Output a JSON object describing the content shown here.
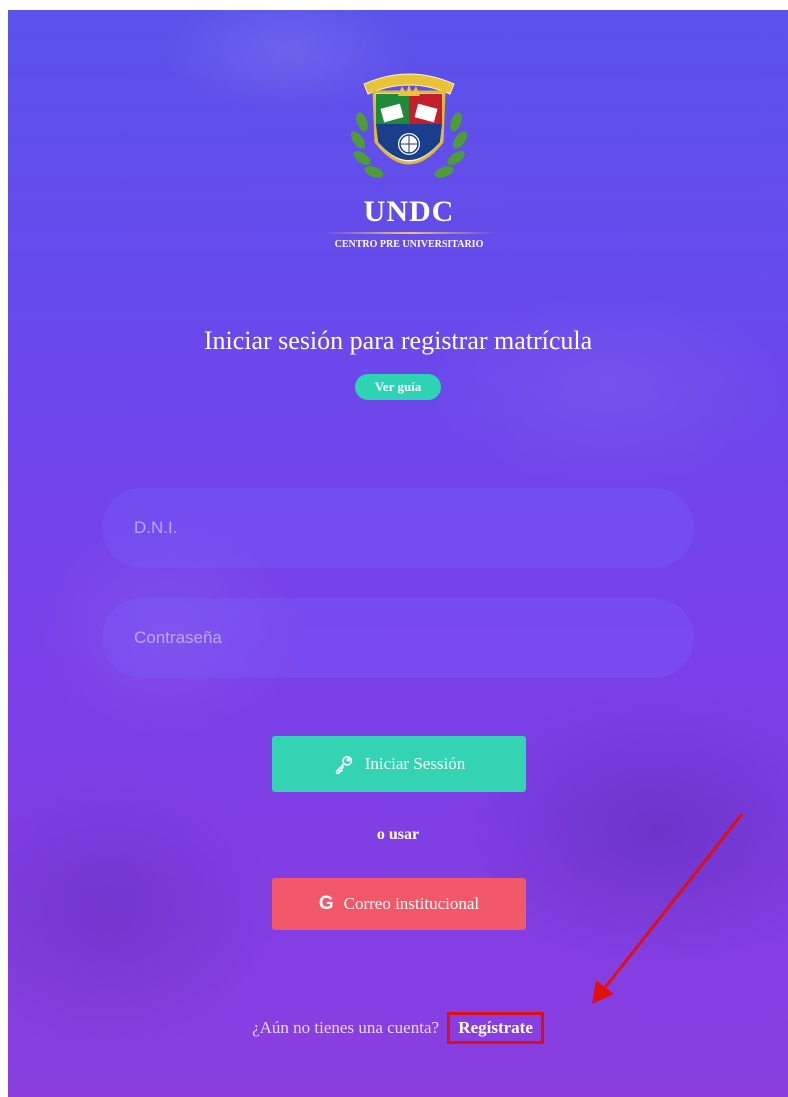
{
  "logo": {
    "name": "UNDC",
    "subtitle": "CENTRO PRE UNIVERSITARIO"
  },
  "heading": "Iniciar sesión para registrar matrícula",
  "guide_button": "Ver guía",
  "form": {
    "dni_placeholder": "D.N.I.",
    "password_placeholder": "Contraseña",
    "login_button": "Iniciar Sessión",
    "or_text": "o usar",
    "google_button": "Correo institucional"
  },
  "signup": {
    "question": "¿Aún no tienes una cuenta?",
    "link": "Regístrate"
  },
  "colors": {
    "accent_teal": "#34d3b4",
    "google_red": "#f2586a",
    "annotation_red": "#e01010"
  },
  "icons": {
    "login": "key-icon",
    "google": "google-icon",
    "arrow": "annotation-arrow"
  }
}
